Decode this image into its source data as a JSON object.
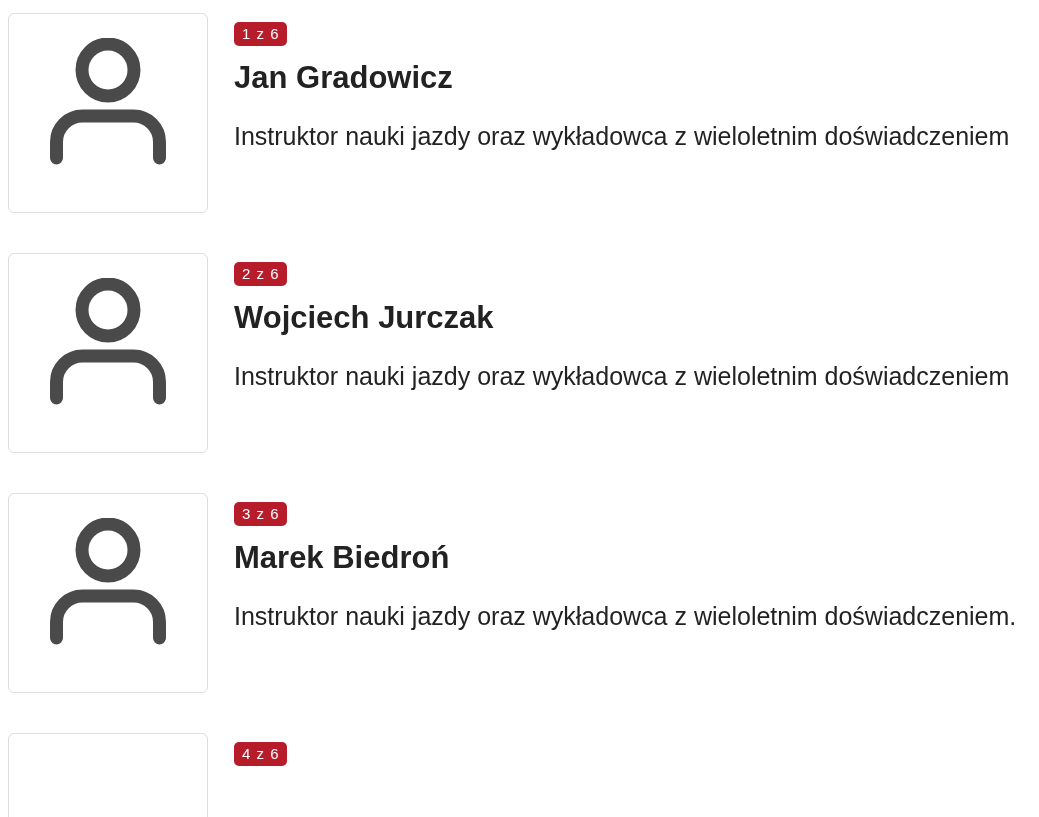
{
  "instructors": [
    {
      "badge": "1 z 6",
      "name": "Jan Gradowicz",
      "description": "Instruktor nauki jazdy oraz wykładowca z wieloletnim doświadczeniem",
      "kind": "person"
    },
    {
      "badge": "2 z 6",
      "name": "Wojciech Jurczak",
      "description": "Instruktor nauki jazdy oraz wykładowca z wieloletnim doświadczeniem",
      "kind": "person"
    },
    {
      "badge": "3 z 6",
      "name": "Marek Biedroń",
      "description": "Instruktor nauki jazdy oraz wykładowca z wieloletnim doświadczeniem.",
      "kind": "person"
    },
    {
      "badge": "4 z 6",
      "kind": "blank"
    }
  ]
}
